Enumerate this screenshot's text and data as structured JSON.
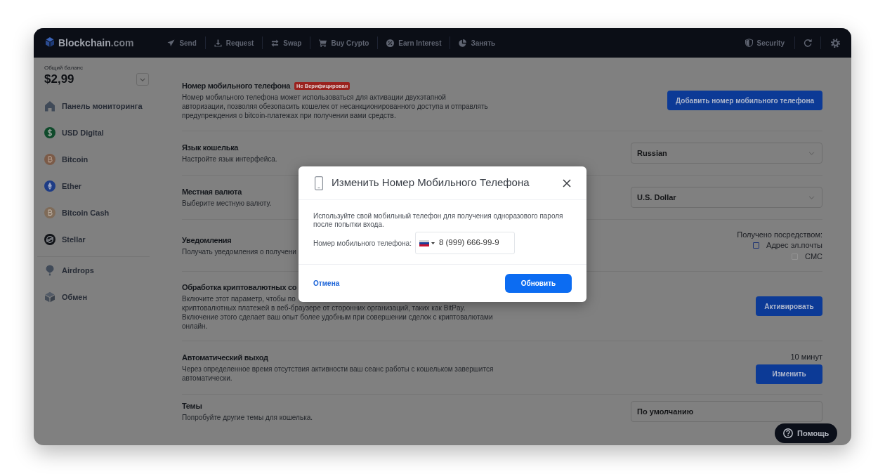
{
  "top_bar": {
    "logo": {
      "text": "Blockchain",
      "suffix": ".com"
    },
    "nav_links": [
      {
        "label": "Send"
      },
      {
        "label": "Request"
      },
      {
        "label": "Swap"
      },
      {
        "label": "Buy Crypto"
      },
      {
        "label": "Earn Interest"
      },
      {
        "label": "Занять"
      }
    ],
    "security": {
      "label": "Security"
    }
  },
  "sidebar": {
    "balance_label": "Общий баланс",
    "balance": "$2,99",
    "sections": [
      {
        "items": [
          {
            "label": "Панель мониторинга",
            "selected": false
          },
          {
            "label": "USD Digital",
            "selected": false
          },
          {
            "label": "Bitcoin",
            "selected": false
          },
          {
            "label": "Ether",
            "selected": false
          },
          {
            "label": "Bitcoin Cash",
            "selected": false
          },
          {
            "label": "Stellar",
            "selected": false
          }
        ]
      },
      {
        "items": [
          {
            "label": "Airdrops",
            "selected": false
          },
          {
            "label": "Обмен",
            "selected": false
          }
        ]
      }
    ]
  },
  "settings": [
    {
      "kind": "button",
      "title": "Номер мобильного телефона",
      "badge": "Не Верифицирован",
      "description": [
        "Номер мобильного телефона может использоваться для активации двухэтапной\nавторизации, позволяя обезопасить кошелек от несанкционированного доступа и отправлять\nпредупреждения о bitcoin-платежах при получении вами средств."
      ],
      "button": "Добавить номер мобильного телефона"
    },
    {
      "kind": "select",
      "title": "Язык кошелька",
      "description": [
        "Настройте язык интерфейса."
      ],
      "value": "Russian",
      "chevron": true
    },
    {
      "kind": "select",
      "title": "Местная валюта",
      "description": [
        "Выберите местную валюту."
      ],
      "value": "U.S. Dollar",
      "chevron": true
    },
    {
      "kind": "checkboxes",
      "title": "Уведомления",
      "description": [
        "Получать уведомления о получени"
      ],
      "label": "Получено посредством:",
      "options": [
        {
          "label": "Адрес эл.почты",
          "checked": false,
          "disabled": false
        },
        {
          "label": "СМС",
          "checked": false,
          "disabled": true
        }
      ]
    },
    {
      "kind": "button",
      "title": "Обработка криптовалютных со",
      "description": [
        "Включите этот параметр, чтобы по",
        "криптовалютных платежей в веб-браузере от сторонних организаций, таких как BitPay.\nВключение этого сделает ваш опыт более удобным при совершении сделок с криптовалютами\nонлайн."
      ],
      "button": "Активировать"
    },
    {
      "kind": "button",
      "title": "Автоматический выход",
      "description": [
        "Через определенное время отсутствия активности ваш сеанс работы с кошельком завершится\nавтоматически."
      ],
      "note": "10 минут",
      "button": "Изменить"
    },
    {
      "kind": "select",
      "title": "Темы",
      "description": [
        "Попробуйте другие темы для кошелька."
      ],
      "value": "По умолчанию",
      "chevron": false
    }
  ],
  "dialog": {
    "title": "Изменить Номер Мобильного Телефона",
    "text": "Используйте свой мобильный телефон для получения одноразового пароля после попытки входа.",
    "field_label": "Номер мобильного телефона:",
    "phone": "8 (999) 666-99-9",
    "cancel": "Отмена",
    "submit": "Обновить"
  },
  "help_button": {
    "label": "Помощь"
  }
}
